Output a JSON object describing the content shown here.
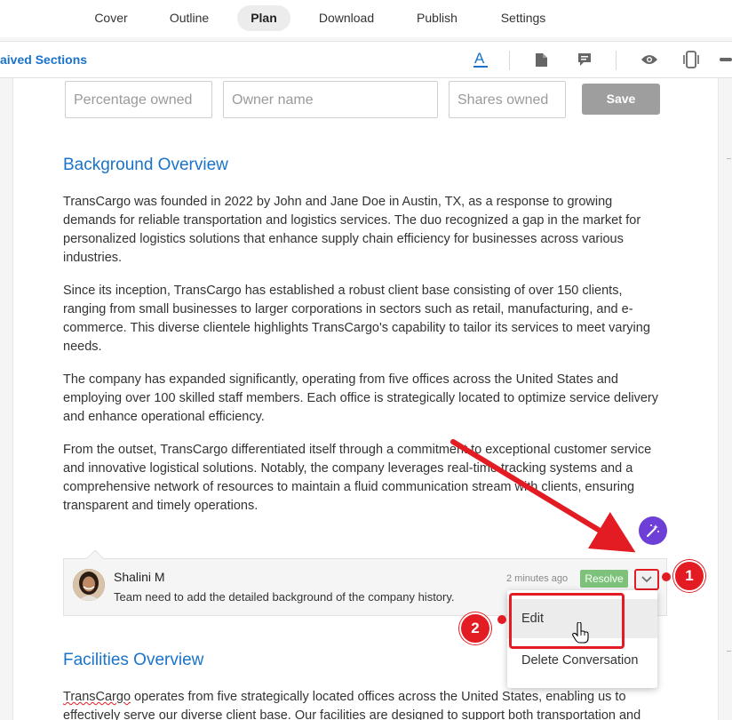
{
  "nav": {
    "tabs": [
      {
        "label": "Cover",
        "active": false
      },
      {
        "label": "Outline",
        "active": false
      },
      {
        "label": "Plan",
        "active": true
      },
      {
        "label": "Download",
        "active": false
      },
      {
        "label": "Publish",
        "active": false
      },
      {
        "label": "Settings",
        "active": false
      }
    ]
  },
  "toolbar": {
    "saved_sections_label": "aived Sections",
    "icons": [
      "text-format-icon",
      "document-icon",
      "comment-icon",
      "eye-icon",
      "mobile-preview-icon",
      "minus-icon"
    ]
  },
  "ownership_form": {
    "percentage_placeholder": "Percentage owned",
    "owner_placeholder": "Owner name",
    "shares_placeholder": "Shares owned",
    "save_label": "Save"
  },
  "sections": {
    "background": {
      "title": "Background Overview",
      "paragraphs": [
        "TransCargo was founded in 2022 by John and Jane Doe in Austin, TX, as a response to growing demands for reliable transportation and logistics services. The duo recognized a gap in the market for personalized logistics solutions that enhance supply chain efficiency for businesses across various industries.",
        "Since its inception, TransCargo has established a robust client base consisting of over 150 clients, ranging from small businesses to larger corporations in sectors such as retail, manufacturing, and e-commerce. This diverse clientele highlights TransCargo's capability to tailor its services to meet varying needs.",
        "The company has expanded significantly, operating from five offices across the United States and employing over 100 skilled staff members. Each office is strategically located to optimize service delivery and enhance operational efficiency.",
        "From the outset, TransCargo differentiated itself through a commitment to exceptional customer service and innovative logistical solutions. Notably, the company leverages real-time tracking systems and a comprehensive network of resources to maintain a fluid communication stream with clients, ensuring transparent and timely operations."
      ]
    },
    "facilities": {
      "title": "Facilities Overview",
      "first_word": "TransCargo",
      "paragraph_rest": " operates from five strategically located offices across the United States, enabling us to effectively serve our diverse client base. Our facilities are designed to support both transportation and"
    }
  },
  "comment": {
    "author": "Shalini M",
    "text": "Team need to add the detailed background of the company history.",
    "timestamp": "2 minutes ago",
    "resolve_label": "Resolve"
  },
  "menu": {
    "items": [
      "Edit",
      "Delete Conversation"
    ]
  },
  "callouts": [
    "1",
    "2"
  ],
  "colors": {
    "accent": "#1a73c8",
    "annotation_red": "#e31b23",
    "resolve_green": "#7dc27a",
    "magic_purple": "#6d3fd6"
  }
}
